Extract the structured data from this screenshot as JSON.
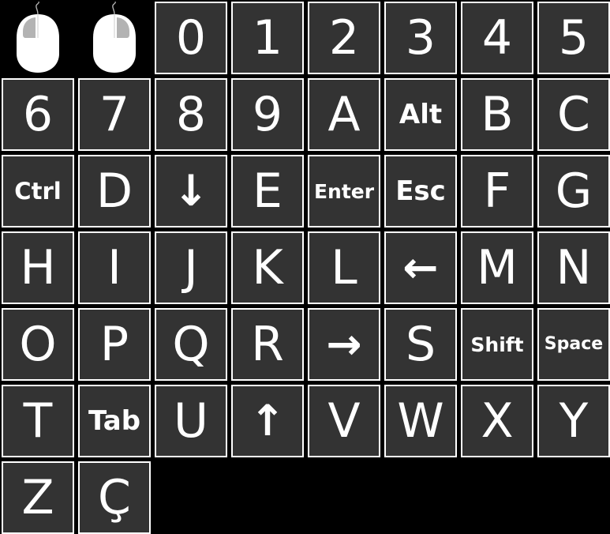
{
  "mice": [
    {
      "name": "mouse-left-click",
      "icon": "mouse-left-button-icon",
      "highlight": "left"
    },
    {
      "name": "mouse-right-click",
      "icon": "mouse-right-button-icon",
      "highlight": "right"
    }
  ],
  "keys": [
    {
      "label": "0",
      "name": "key-0"
    },
    {
      "label": "1",
      "name": "key-1"
    },
    {
      "label": "2",
      "name": "key-2"
    },
    {
      "label": "3",
      "name": "key-3"
    },
    {
      "label": "4",
      "name": "key-4"
    },
    {
      "label": "5",
      "name": "key-5"
    },
    {
      "label": "6",
      "name": "key-6"
    },
    {
      "label": "7",
      "name": "key-7"
    },
    {
      "label": "8",
      "name": "key-8"
    },
    {
      "label": "9",
      "name": "key-9"
    },
    {
      "label": "A",
      "name": "key-a"
    },
    {
      "label": "Alt",
      "name": "key-alt"
    },
    {
      "label": "B",
      "name": "key-b"
    },
    {
      "label": "C",
      "name": "key-c"
    },
    {
      "label": "Ctrl",
      "name": "key-ctrl"
    },
    {
      "label": "D",
      "name": "key-d"
    },
    {
      "label": "↓",
      "name": "key-arrow-down",
      "icon": "arrow-down-icon"
    },
    {
      "label": "E",
      "name": "key-e"
    },
    {
      "label": "Enter",
      "name": "key-enter"
    },
    {
      "label": "Esc",
      "name": "key-esc"
    },
    {
      "label": "F",
      "name": "key-f"
    },
    {
      "label": "G",
      "name": "key-g"
    },
    {
      "label": "H",
      "name": "key-h"
    },
    {
      "label": "I",
      "name": "key-i"
    },
    {
      "label": "J",
      "name": "key-j"
    },
    {
      "label": "K",
      "name": "key-k"
    },
    {
      "label": "L",
      "name": "key-l"
    },
    {
      "label": "←",
      "name": "key-arrow-left",
      "icon": "arrow-left-icon"
    },
    {
      "label": "M",
      "name": "key-m"
    },
    {
      "label": "N",
      "name": "key-n"
    },
    {
      "label": "O",
      "name": "key-o"
    },
    {
      "label": "P",
      "name": "key-p"
    },
    {
      "label": "Q",
      "name": "key-q"
    },
    {
      "label": "R",
      "name": "key-r"
    },
    {
      "label": "→",
      "name": "key-arrow-right",
      "icon": "arrow-right-icon"
    },
    {
      "label": "S",
      "name": "key-s"
    },
    {
      "label": "Shift",
      "name": "key-shift"
    },
    {
      "label": "Space",
      "name": "key-space"
    },
    {
      "label": "T",
      "name": "key-t"
    },
    {
      "label": "Tab",
      "name": "key-tab"
    },
    {
      "label": "U",
      "name": "key-u"
    },
    {
      "label": "↑",
      "name": "key-arrow-up",
      "icon": "arrow-up-icon"
    },
    {
      "label": "V",
      "name": "key-v"
    },
    {
      "label": "W",
      "name": "key-w"
    },
    {
      "label": "X",
      "name": "key-x"
    },
    {
      "label": "Y",
      "name": "key-y"
    },
    {
      "label": "Z",
      "name": "key-z"
    },
    {
      "label": "Ç",
      "name": "key-c-cedilla"
    }
  ],
  "colors": {
    "background": "#000000",
    "key_fill": "#333333",
    "key_border": "#ffffff",
    "key_text": "#ffffff",
    "mouse_body": "#ffffff",
    "mouse_button_highlight": "#b3b3b3"
  }
}
